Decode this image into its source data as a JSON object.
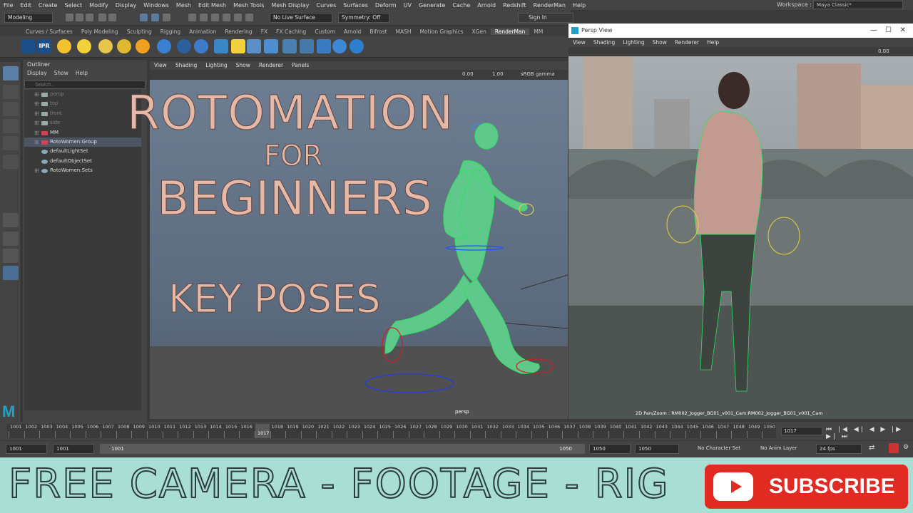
{
  "menubar": {
    "items": [
      "File",
      "Edit",
      "Create",
      "Select",
      "Modify",
      "Display",
      "Windows",
      "Mesh",
      "Edit Mesh",
      "Mesh Tools",
      "Mesh Display",
      "Curves",
      "Surfaces",
      "Deform",
      "UV",
      "Generate",
      "Cache",
      "Arnold",
      "Redshift",
      "RenderMan",
      "Help"
    ],
    "workspace_label": "Workspace :",
    "workspace_value": "Maya Classic*"
  },
  "statusline": {
    "mode": "Modeling",
    "live_surface": "No Live Surface",
    "symmetry": "Symmetry: Off",
    "sign_in": "Sign In"
  },
  "shelf": {
    "tabs": [
      "Curves / Surfaces",
      "Poly Modeling",
      "Sculpting",
      "Rigging",
      "Animation",
      "Rendering",
      "FX",
      "FX Caching",
      "Custom",
      "Arnold",
      "Bifrost",
      "MASH",
      "Motion Graphics",
      "XGen",
      "RenderMan",
      "MM"
    ],
    "active_tab": "RenderMan",
    "ipr_label": "IPR"
  },
  "outliner": {
    "title": "Outliner",
    "menu": [
      "Display",
      "Show",
      "Help"
    ],
    "search_placeholder": "Search...",
    "items": [
      {
        "label": "persp",
        "dim": true
      },
      {
        "label": "top",
        "dim": true
      },
      {
        "label": "front",
        "dim": true
      },
      {
        "label": "side",
        "dim": true
      },
      {
        "label": "MM",
        "dim": false
      },
      {
        "label": "RotoWomen:Group",
        "dim": false,
        "selected": true
      },
      {
        "label": "defaultLightSet",
        "dim": false
      },
      {
        "label": "defaultObjectSet",
        "dim": false
      },
      {
        "label": "RotoWomen:Sets",
        "dim": false
      }
    ]
  },
  "viewport_left": {
    "menu": [
      "View",
      "Shading",
      "Lighting",
      "Show",
      "Renderer",
      "Panels"
    ],
    "value_a": "0.00",
    "value_b": "1.00",
    "color_space": "sRGB gamma",
    "camera_label": "persp"
  },
  "viewport_right": {
    "window_title": "Persp View",
    "menu": [
      "View",
      "Shading",
      "Lighting",
      "Show",
      "Renderer",
      "Help"
    ],
    "value": "0.00",
    "caption": "2D Pan/Zoom : RM002_Jogger_BG01_v001_Cam:RM002_Jogger_BG01_v001_Cam"
  },
  "overlay": {
    "line1": "ROTOMATION",
    "line2": "FOR",
    "line3": "BEGINNERS",
    "line4": "KEY POSES"
  },
  "timeline": {
    "ticks": [
      "1001",
      "1002",
      "1003",
      "1004",
      "1005",
      "1006",
      "1007",
      "1008",
      "1009",
      "1010",
      "1011",
      "1012",
      "1013",
      "1014",
      "1015",
      "1016",
      "1017",
      "1018",
      "1019",
      "1020",
      "1021",
      "1022",
      "1023",
      "1024",
      "1025",
      "1026",
      "1027",
      "1028",
      "1029",
      "1030",
      "1031",
      "1032",
      "1033",
      "1034",
      "1035",
      "1036",
      "1037",
      "1038",
      "1039",
      "1040",
      "1041",
      "1042",
      "1043",
      "1044",
      "1045",
      "1046",
      "1047",
      "1048",
      "1049",
      "1050"
    ],
    "current_frame": "1017",
    "frame_field": "1017",
    "controls": "⏮ |◀ ◀| ◀ ▶ |▶ ▶| ⏭"
  },
  "range": {
    "start_a": "1001",
    "start_b": "1001",
    "slider_start": "1001",
    "slider_end": "1050",
    "end_a": "1050",
    "end_b": "1050",
    "character_set": "No Character Set",
    "anim_layer": "No Anim Layer",
    "fps": "24 fps"
  },
  "banner": {
    "text": "FREE CAMERA - FOOTAGE - RIG",
    "subscribe_label": "SUBSCRIBE",
    "subscribe_color": "#e02a22",
    "background_color": "#a9ded5"
  },
  "logo": "M"
}
